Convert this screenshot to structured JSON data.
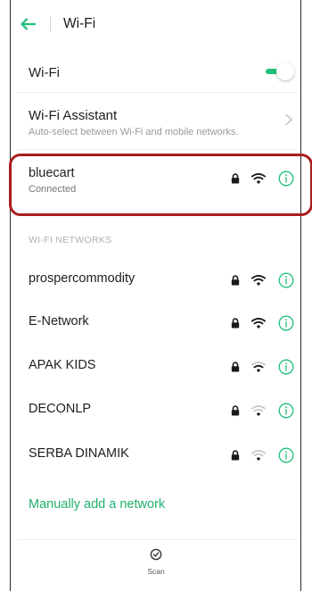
{
  "header": {
    "title": "Wi-Fi"
  },
  "wifi_toggle": {
    "label": "Wi-Fi",
    "state": "on"
  },
  "assistant": {
    "label": "Wi-Fi Assistant",
    "subtitle": "Auto-select between Wi-Fi and mobile networks."
  },
  "connected": {
    "name": "bluecart",
    "status": "Connected",
    "secured": true,
    "signal": 3
  },
  "section_header": "WI-FI NETWORKS",
  "networks": [
    {
      "name": "prospercommodity",
      "secured": true,
      "signal": 3
    },
    {
      "name": "E-Network",
      "secured": true,
      "signal": 3
    },
    {
      "name": "APAK KIDS",
      "secured": true,
      "signal": 2
    },
    {
      "name": "DECONLP",
      "secured": true,
      "signal": 1
    },
    {
      "name": "SERBA DINAMIK",
      "secured": true,
      "signal": 1
    }
  ],
  "manual_add": "Manually add a network",
  "scan": {
    "label": "Scan"
  },
  "colors": {
    "accent": "#1fbf79",
    "highlight_border": "#a91e1e"
  }
}
